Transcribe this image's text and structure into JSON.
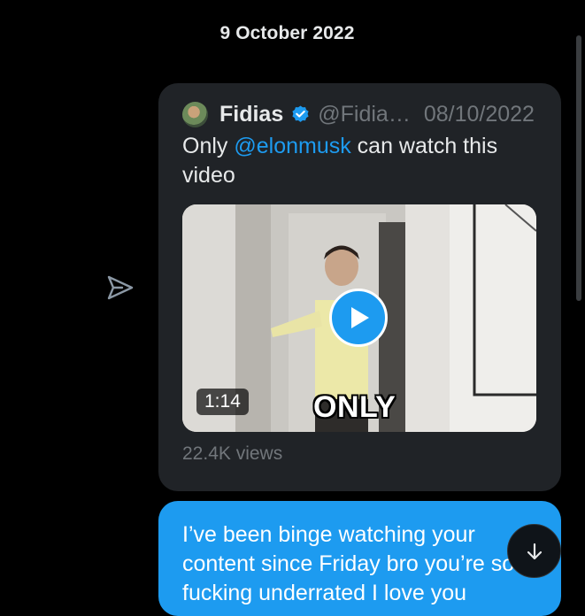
{
  "conversation": {
    "date_separator": "9 October 2022"
  },
  "quoted_tweet": {
    "author_name": "Fidias",
    "author_handle": "@Fidia…",
    "date": "08/10/2022",
    "text_before": "Only ",
    "mention": "@elonmusk",
    "text_after": " can watch this video",
    "video": {
      "duration": "1:14",
      "caption": "ONLY"
    },
    "views": "22.4K views"
  },
  "message": {
    "text": "I’ve been binge watching your content since Friday bro you’re so fucking underrated I love you"
  },
  "colors": {
    "background": "#000000",
    "card": "#202327",
    "accent": "#1d9bf0",
    "muted_text": "#71767b"
  },
  "icons": {
    "share": "send-icon",
    "verified": "verified-badge-icon",
    "play": "play-icon",
    "scroll": "arrow-down-icon"
  }
}
